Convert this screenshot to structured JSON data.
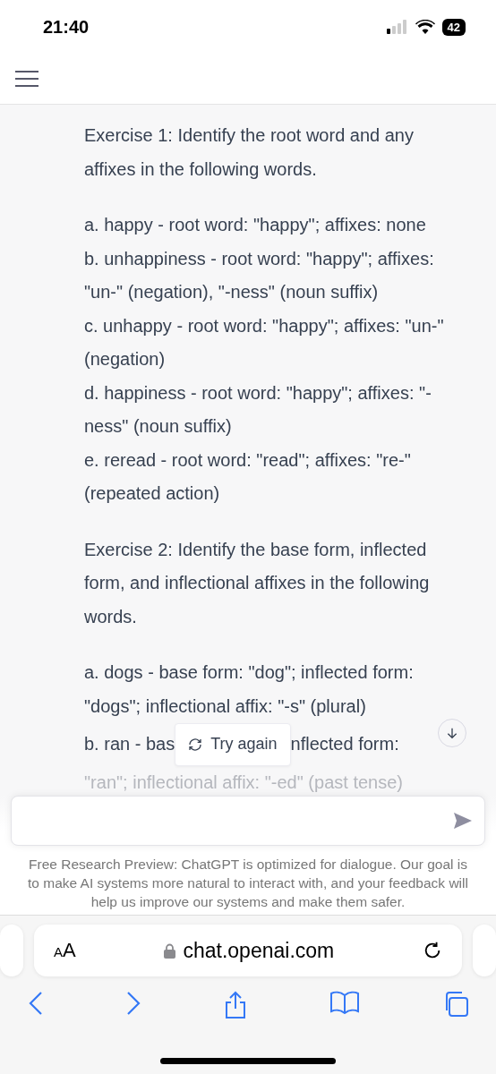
{
  "status_bar": {
    "time": "21:40",
    "battery": "42"
  },
  "exercises": [
    {
      "heading": "Exercise 1: Identify the root word and any affixes in the following words.",
      "items": [
        {
          "kind": "text",
          "text": "a. happy - root word: \"happy\"; affixes: none"
        },
        {
          "kind": "text",
          "text": "b. unhappiness - root word: \"happy\"; affixes: \"un-\" (negation), \"-ness\" (noun suffix)"
        },
        {
          "kind": "text",
          "text": "c. unhappy - root word: \"happy\"; affixes: \"un-\" (negation)"
        },
        {
          "kind": "text",
          "text": "d. happiness - root word: \"happy\"; affixes: \"-ness\" (noun suffix)"
        },
        {
          "kind": "text",
          "text": "e. reread - root word: \"read\"; affixes: \"re-\" (repeated action)"
        }
      ]
    },
    {
      "heading": "Exercise 2: Identify the base form, inflected form, and inflectional affixes in the following words.",
      "items": [
        {
          "kind": "text",
          "text": "a. dogs - base form: \"dog\"; inflected form: \"dogs\"; inflectional affix: \"-s\" (plural)"
        },
        {
          "kind": "interrupted",
          "before": "b. ran - bas",
          "after": "nflected form:"
        },
        {
          "kind": "faded",
          "text": "\"ran\"; inflectional affix: \"-ed\" (past tense)"
        }
      ]
    }
  ],
  "try_again": {
    "label": "Try again"
  },
  "disclaimer": "Free Research Preview: ChatGPT is optimized for dialogue. Our goal is to make AI systems more natural to interact with, and your feedback will help us improve our systems and make them safer.",
  "browser": {
    "text_size": "AA",
    "url": "chat.openai.com"
  }
}
